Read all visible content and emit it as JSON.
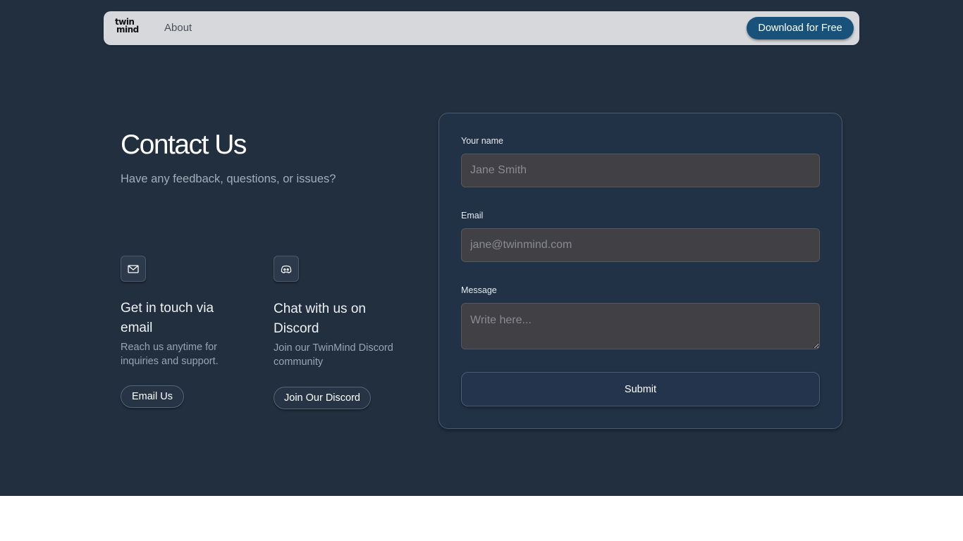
{
  "nav": {
    "logo_line1": "twin",
    "logo_line2": "mind",
    "about": "About",
    "download": "Download for Free"
  },
  "hero": {
    "title": "Contact Us",
    "subtitle": "Have any feedback, questions, or issues?"
  },
  "cards": [
    {
      "icon": "mail-icon",
      "title": "Get in touch via email",
      "description": "Reach us anytime for inquiries and support.",
      "button": "Email Us"
    },
    {
      "icon": "discord-icon",
      "title": "Chat with us on Discord",
      "description": "Join our TwinMind Discord community",
      "button": "Join Our Discord"
    }
  ],
  "form": {
    "name_label": "Your name",
    "name_placeholder": "Jane Smith",
    "email_label": "Email",
    "email_placeholder": "jane@twinmind.com",
    "message_label": "Message",
    "message_placeholder": "Write here...",
    "submit": "Submit"
  },
  "colors": {
    "background": "#222f3e",
    "nav_bg": "#d7d8dc",
    "primary_button": "#18527b",
    "logo_accent": "#e46a2a",
    "card_bg": "#213146"
  }
}
